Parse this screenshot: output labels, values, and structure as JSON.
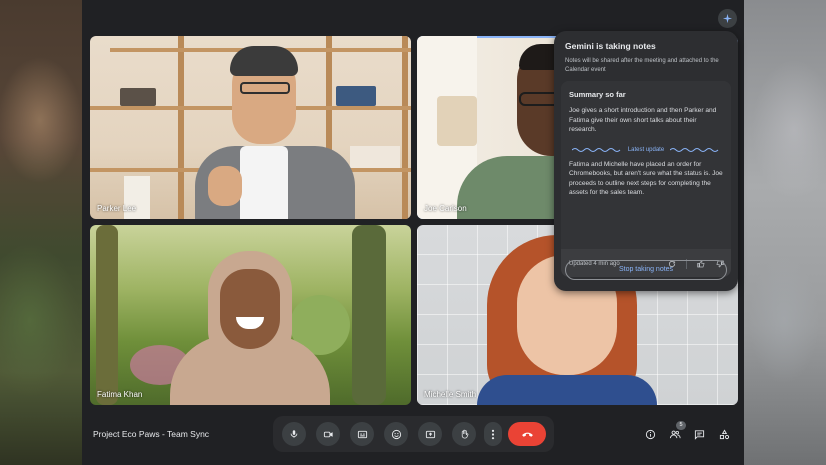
{
  "meeting": {
    "title": "Project Eco Paws - Team Sync"
  },
  "participants": [
    {
      "name": "Parker Lee"
    },
    {
      "name": "Joe Carlson"
    },
    {
      "name": "Fatima Khan"
    },
    {
      "name": "Michelle Smith"
    }
  ],
  "gemini": {
    "title": "Gemini is taking notes",
    "subtitle": "Notes will be shared after the meeting and attached to the Calendar event",
    "summary_heading": "Summary so far",
    "summary_text": "Joe gives a short introduction and then Parker and Fatima give their own short talks about their research.",
    "latest_label": "Latest update",
    "latest_text": "Fatima and Michelle have placed an order for Chromebooks, but aren't sure what the status is. Joe proceeds to outline next steps for completing the assets for the sales team.",
    "updated": "Updated 4 min ago",
    "stop_label": "Stop taking notes"
  },
  "controls": {
    "icons": [
      "mic-icon",
      "camera-icon",
      "captions-icon",
      "emoji-icon",
      "present-icon",
      "raise-hand-icon",
      "more-options-icon",
      "end-call-icon"
    ]
  },
  "right_controls": {
    "people_count": "5",
    "icons": [
      "info-icon",
      "people-icon",
      "chat-icon",
      "activities-icon"
    ]
  },
  "colors": {
    "accent": "#8ab4f8",
    "hangup": "#ea4335",
    "panel": "#2d2e31"
  }
}
